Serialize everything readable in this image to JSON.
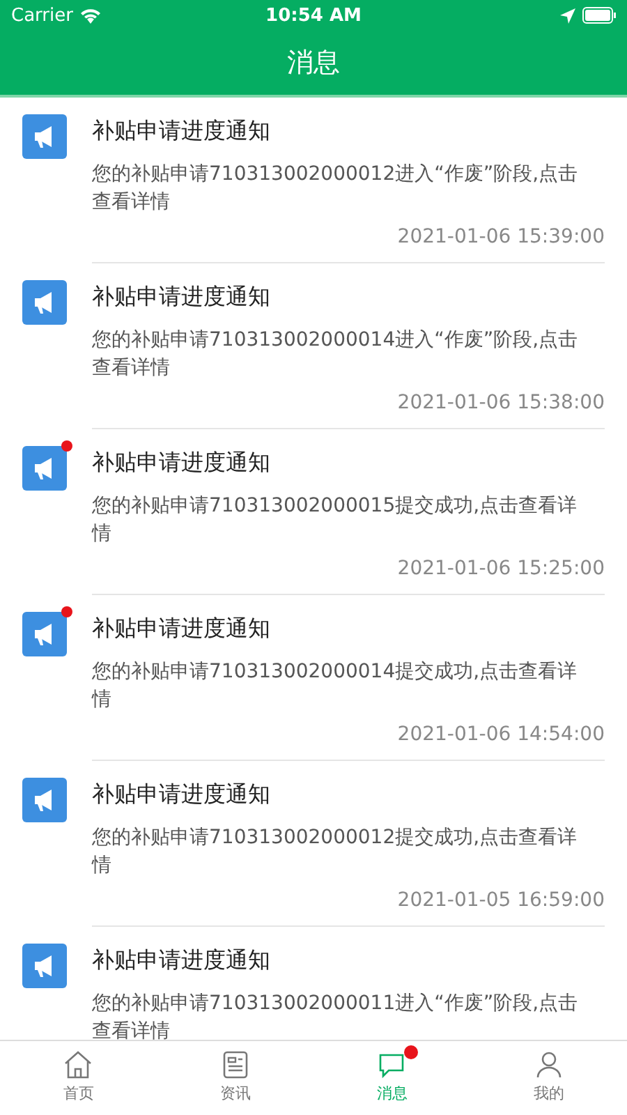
{
  "status_bar": {
    "carrier": "Carrier",
    "time": "10:54 AM"
  },
  "nav_bar": {
    "title": "消息"
  },
  "messages": [
    {
      "title": "补贴申请进度通知",
      "body": "您的补贴申请710313002000012进入“作废”阶段,点击查看详情",
      "time": "2021-01-06 15:39:00",
      "unread": false
    },
    {
      "title": "补贴申请进度通知",
      "body": "您的补贴申请710313002000014进入“作废”阶段,点击查看详情",
      "time": "2021-01-06 15:38:00",
      "unread": false
    },
    {
      "title": "补贴申请进度通知",
      "body": "您的补贴申请710313002000015提交成功,点击查看详情",
      "time": "2021-01-06 15:25:00",
      "unread": true
    },
    {
      "title": "补贴申请进度通知",
      "body": "您的补贴申请710313002000014提交成功,点击查看详情",
      "time": "2021-01-06 14:54:00",
      "unread": true
    },
    {
      "title": "补贴申请进度通知",
      "body": "您的补贴申请710313002000012提交成功,点击查看详情",
      "time": "2021-01-05 16:59:00",
      "unread": false
    },
    {
      "title": "补贴申请进度通知",
      "body": "您的补贴申请710313002000011进入“作废”阶段,点击查看详情",
      "unread": false
    }
  ],
  "tab_bar": [
    {
      "label": "首页",
      "kind": "home",
      "selected": false,
      "badge": false
    },
    {
      "label": "资讯",
      "kind": "news",
      "selected": false,
      "badge": false
    },
    {
      "label": "消息",
      "kind": "message",
      "selected": true,
      "badge": true
    },
    {
      "label": "我的",
      "kind": "profile",
      "selected": false,
      "badge": false
    }
  ]
}
